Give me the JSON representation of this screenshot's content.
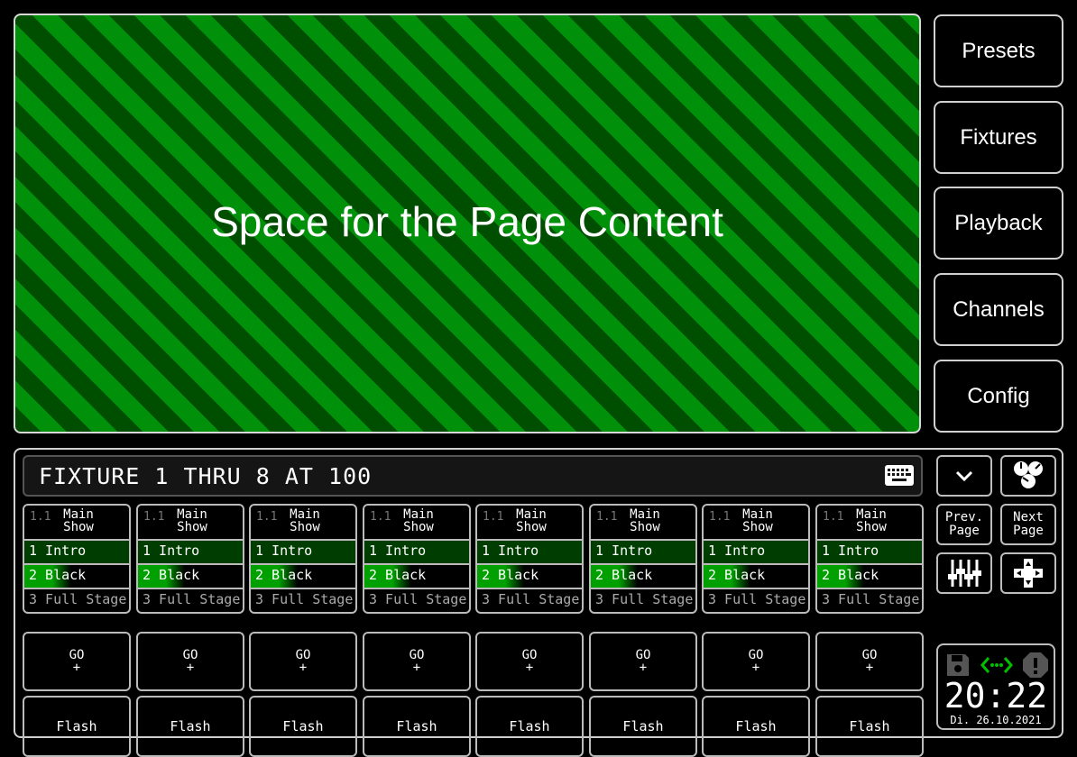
{
  "content": {
    "placeholder": "Space for the Page Content"
  },
  "nav": [
    "Presets",
    "Fixtures",
    "Playback",
    "Channels",
    "Config"
  ],
  "command_line": "FIXTURE 1 THRU 8 AT 100",
  "pager": {
    "prev": [
      "Prev.",
      "Page"
    ],
    "next": [
      "Next",
      "Page"
    ]
  },
  "playbacks": [
    {
      "index": "1.1",
      "name": [
        "Main",
        "Show"
      ],
      "cues": [
        "1 Intro",
        "2 Black",
        "3 Full Stage"
      ],
      "go": [
        "GO",
        "+"
      ],
      "flash": "Flash"
    },
    {
      "index": "1.1",
      "name": [
        "Main",
        "Show"
      ],
      "cues": [
        "1 Intro",
        "2 Black",
        "3 Full Stage"
      ],
      "go": [
        "GO",
        "+"
      ],
      "flash": "Flash"
    },
    {
      "index": "1.1",
      "name": [
        "Main",
        "Show"
      ],
      "cues": [
        "1 Intro",
        "2 Black",
        "3 Full Stage"
      ],
      "go": [
        "GO",
        "+"
      ],
      "flash": "Flash"
    },
    {
      "index": "1.1",
      "name": [
        "Main",
        "Show"
      ],
      "cues": [
        "1 Intro",
        "2 Black",
        "3 Full Stage"
      ],
      "go": [
        "GO",
        "+"
      ],
      "flash": "Flash"
    },
    {
      "index": "1.1",
      "name": [
        "Main",
        "Show"
      ],
      "cues": [
        "1 Intro",
        "2 Black",
        "3 Full Stage"
      ],
      "go": [
        "GO",
        "+"
      ],
      "flash": "Flash"
    },
    {
      "index": "1.1",
      "name": [
        "Main",
        "Show"
      ],
      "cues": [
        "1 Intro",
        "2 Black",
        "3 Full Stage"
      ],
      "go": [
        "GO",
        "+"
      ],
      "flash": "Flash"
    },
    {
      "index": "1.1",
      "name": [
        "Main",
        "Show"
      ],
      "cues": [
        "1 Intro",
        "2 Black",
        "3 Full Stage"
      ],
      "go": [
        "GO",
        "+"
      ],
      "flash": "Flash"
    },
    {
      "index": "1.1",
      "name": [
        "Main",
        "Show"
      ],
      "cues": [
        "1 Intro",
        "2 Black",
        "3 Full Stage"
      ],
      "go": [
        "GO",
        "+"
      ],
      "flash": "Flash"
    }
  ],
  "status": {
    "time": "20:22",
    "date": "Di. 26.10.2021",
    "connection_color": "#00c000"
  },
  "icons": [
    "keyboard-icon",
    "chevron-down-icon",
    "color-wheels-icon",
    "faders-icon",
    "dpad-icon",
    "save-icon",
    "connection-icon",
    "warning-icon"
  ],
  "colors": {
    "stripe_dark": "#004f00",
    "stripe_light": "#00900a",
    "cue_active": "#003d00",
    "cue_progress": "#00a000"
  }
}
